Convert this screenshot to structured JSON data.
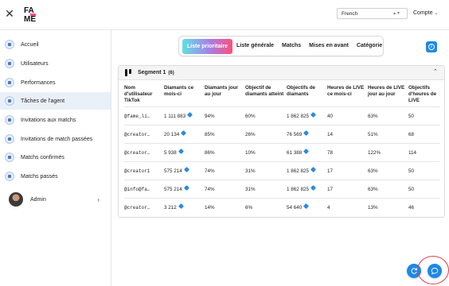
{
  "header": {
    "language_value": "French",
    "account_label": "Compte"
  },
  "sidebar": {
    "items": [
      {
        "label": "Accueil"
      },
      {
        "label": "Utilisateurs"
      },
      {
        "label": "Performances"
      },
      {
        "label": "Tâches de l'agent"
      },
      {
        "label": "Invitations aux matchs"
      },
      {
        "label": "Invitations de match passées"
      },
      {
        "label": "Matchs confirmés"
      },
      {
        "label": "Matchs passés"
      }
    ],
    "active_index": 3,
    "user_label": "Admin"
  },
  "tabs": [
    {
      "label": "Liste prioritaire"
    },
    {
      "label": "Liste générale"
    },
    {
      "label": "Matchs"
    },
    {
      "label": "Mises en avant"
    },
    {
      "label": "Catégorie"
    }
  ],
  "active_tab": 0,
  "segment": {
    "title": "Segment 1",
    "count": "(6)"
  },
  "table": {
    "headers": [
      "Nom d'utilisateur TikTok",
      "Diamants ce mois-ci",
      "Diamants jour au jour",
      "Objectif de diamants atteint",
      "Objectifs de diamants",
      "Heures de LIVE ce mois-ci",
      "Heures de LIVE jour au jour",
      "Objectifs d'heures de LIVE"
    ],
    "rows": [
      [
        "@fame_li…",
        "1 111 883",
        "94%",
        "60%",
        "1 862 825",
        "40",
        "63%",
        "50"
      ],
      [
        "@creator…",
        "20 134",
        "85%",
        "26%",
        "76 569",
        "14",
        "51%",
        "68"
      ],
      [
        "@creator…",
        "5 938",
        "86%",
        "10%",
        "61 388",
        "78",
        "122%",
        "114"
      ],
      [
        "@creator1",
        "575 214",
        "74%",
        "31%",
        "1 862 825",
        "17",
        "63%",
        "50"
      ],
      [
        "@info@fa…",
        "575 214",
        "74%",
        "31%",
        "1 862 825",
        "17",
        "63%",
        "50"
      ],
      [
        "@creator…",
        "3 212",
        "14%",
        "6%",
        "54 640",
        "4",
        "13%",
        "46"
      ]
    ]
  },
  "colors": {
    "accent": "#1e88e5",
    "active_nav_bg": "#eaf0f8",
    "tab_gradient_start": "#5fe0e6",
    "tab_gradient_end": "#ff4f7a",
    "annotation_ring": "#e23a4a"
  },
  "icons": {
    "close": "close-icon",
    "diamond": "diamond-icon",
    "info": "info-icon",
    "refresh": "refresh-icon",
    "chat": "chat-icon"
  }
}
